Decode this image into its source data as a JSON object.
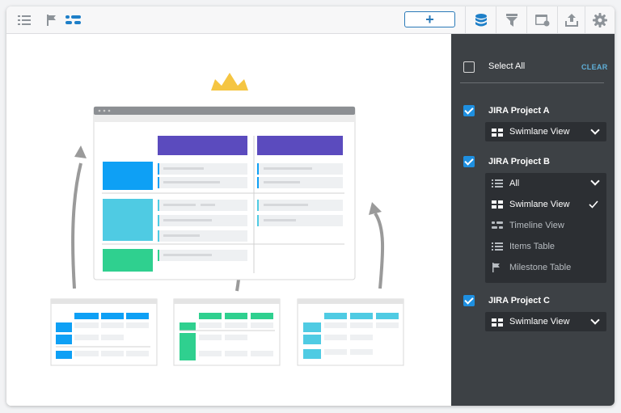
{
  "toolbar": {
    "left_icons": [
      "list-icon",
      "flag-icon",
      "swimlane-icon"
    ],
    "add_label": "+",
    "right_icons": [
      "database-icon",
      "filter-icon",
      "calendar-settings-icon",
      "export-icon",
      "gear-icon"
    ]
  },
  "panel": {
    "select_all": "Select All",
    "clear": "CLEAR",
    "projects": [
      {
        "name": "JIRA Project A",
        "checked": true,
        "view": "Swimlane View"
      },
      {
        "name": "JIRA Project B",
        "checked": true,
        "view": "All"
      },
      {
        "name": "JIRA Project C",
        "checked": true,
        "view": "Swimlane View"
      }
    ],
    "dropdown": {
      "options": [
        {
          "label": "All",
          "icon": "list-icon"
        },
        {
          "label": "Swimlane View",
          "icon": "swimlane-icon",
          "selected": true
        },
        {
          "label": "Timeline View",
          "icon": "timeline-icon"
        },
        {
          "label": "Items Table",
          "icon": "list-icon"
        },
        {
          "label": "Milestone Table",
          "icon": "flag-icon"
        }
      ]
    }
  },
  "colors": {
    "accent": "#1e8fe0",
    "panel_bg": "#3d4145",
    "clear": "#5fb0d9",
    "purple": "#5b4bbe",
    "blue": "#0ea0f5",
    "cyan": "#4fcbe3",
    "green": "#2fd08f",
    "crown": "#f5c542"
  }
}
